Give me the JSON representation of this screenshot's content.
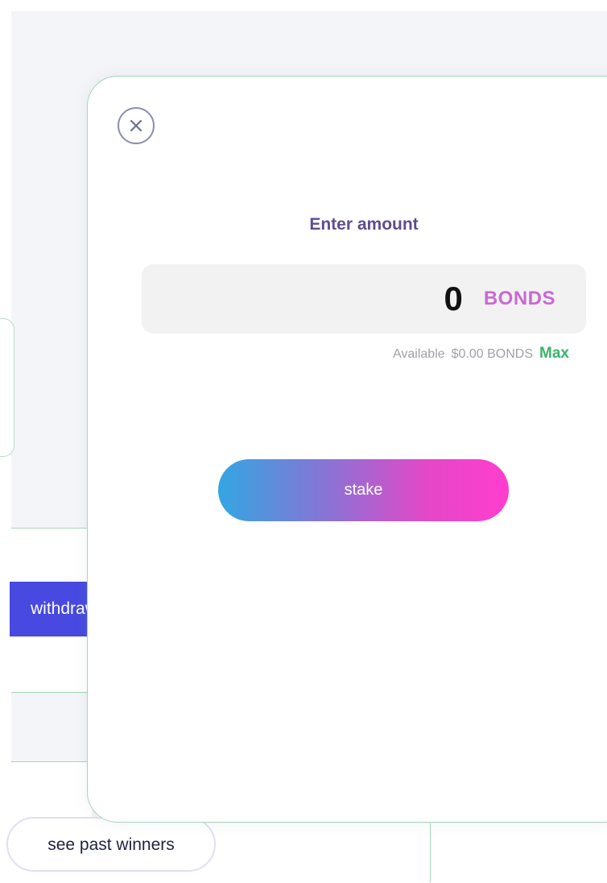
{
  "background": {
    "withdraw_label": "withdraw",
    "past_winners_label": "see past winners"
  },
  "modal": {
    "close_icon": "close-x-circle",
    "title": "Enter amount",
    "amount": {
      "value": "0",
      "unit": "BONDS"
    },
    "balance": {
      "label": "Available",
      "value": "$0.00 BONDS",
      "max_label": "Max"
    },
    "stake_label": "stake"
  },
  "colors": {
    "title": "#5e4d8f",
    "unit": "#c96ad0",
    "max": "#38b56c",
    "border_accent": "#a6d6b8",
    "withdraw_button": "#4749e0",
    "stake_gradient_start": "#33a6e3",
    "stake_gradient_end": "#ff3dcf"
  }
}
